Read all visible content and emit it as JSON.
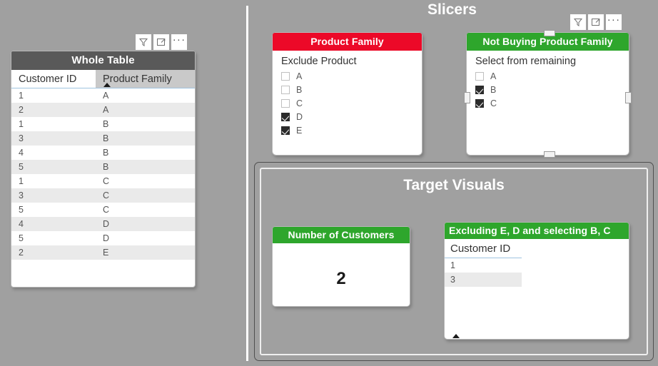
{
  "background_color": "#a0a0a0",
  "sections": {
    "slicers_heading": "Slicers",
    "target_heading": "Target Visuals"
  },
  "toolbar": {
    "filter_icon": "filter-funnel-icon",
    "focus_icon": "focus-mode-icon",
    "more_icon": "more-options-icon"
  },
  "whole_table": {
    "title": "Whole Table",
    "title_bg": "#595959",
    "columns": [
      "Customer ID",
      "Product Family"
    ],
    "sorted_column": "Product Family",
    "sort_direction": "ascending",
    "rows": [
      [
        "1",
        "A"
      ],
      [
        "2",
        "A"
      ],
      [
        "1",
        "B"
      ],
      [
        "3",
        "B"
      ],
      [
        "4",
        "B"
      ],
      [
        "5",
        "B"
      ],
      [
        "1",
        "C"
      ],
      [
        "3",
        "C"
      ],
      [
        "5",
        "C"
      ],
      [
        "4",
        "D"
      ],
      [
        "5",
        "D"
      ],
      [
        "2",
        "E"
      ]
    ]
  },
  "slicer_product_family": {
    "title": "Product Family",
    "title_bg": "#ec0928",
    "subtitle": "Exclude Product",
    "items": [
      {
        "label": "A",
        "checked": false
      },
      {
        "label": "B",
        "checked": false
      },
      {
        "label": "C",
        "checked": false
      },
      {
        "label": "D",
        "checked": true
      },
      {
        "label": "E",
        "checked": true
      }
    ]
  },
  "slicer_not_buying": {
    "title": "Not Buying Product Family",
    "title_bg": "#2ea62c",
    "subtitle": "Select from remaining",
    "items": [
      {
        "label": "A",
        "checked": false
      },
      {
        "label": "B",
        "checked": true
      },
      {
        "label": "C",
        "checked": true
      }
    ]
  },
  "card_number_customers": {
    "title": "Number of Customers",
    "title_bg": "#2ea62c",
    "value": "2"
  },
  "result_table": {
    "title": "Excluding E, D and selecting B, C",
    "title_bg": "#2ea62c",
    "columns": [
      "Customer ID"
    ],
    "sorted_column": "Customer ID",
    "sort_direction": "ascending",
    "rows": [
      [
        "1"
      ],
      [
        "3"
      ]
    ]
  }
}
